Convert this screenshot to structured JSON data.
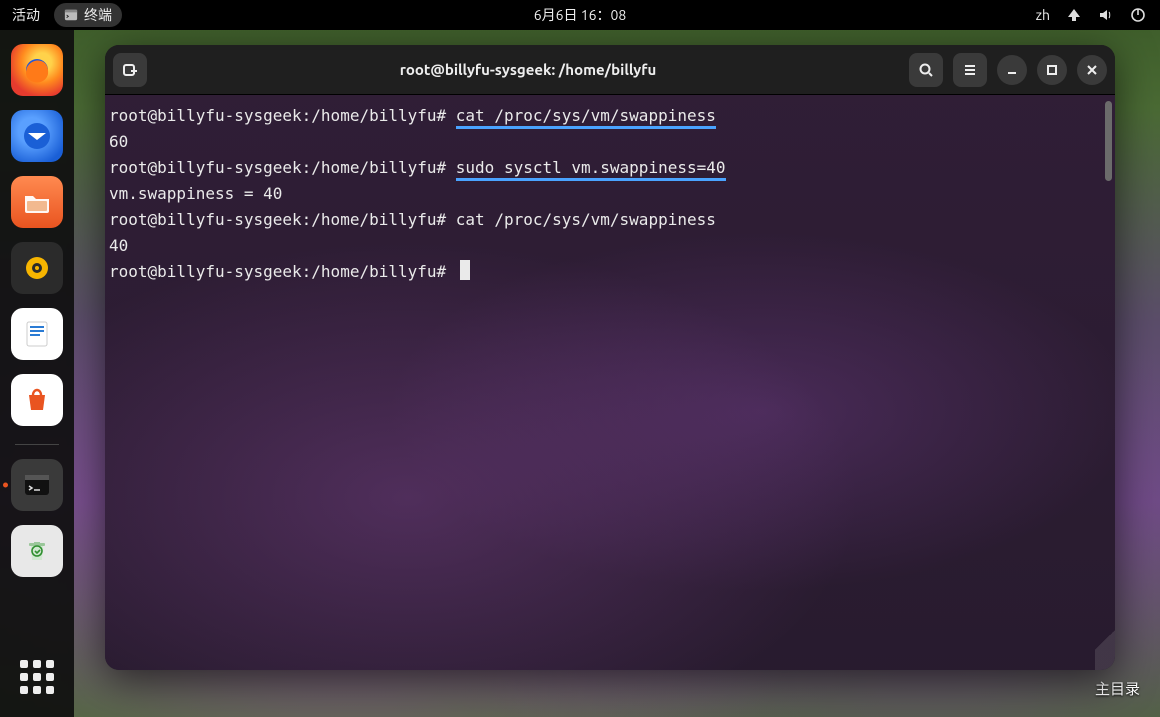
{
  "panel": {
    "activities": "活动",
    "app_menu": "终端",
    "clock": "6月6日 16：08",
    "ime": "zh"
  },
  "dock": {
    "items": [
      {
        "name": "firefox"
      },
      {
        "name": "thunderbird"
      },
      {
        "name": "files"
      },
      {
        "name": "rhythmbox"
      },
      {
        "name": "libreoffice-writer"
      },
      {
        "name": "ubuntu-software"
      },
      {
        "name": "terminal",
        "running": true
      },
      {
        "name": "trash"
      }
    ]
  },
  "desktop": {
    "home_label": "主目录"
  },
  "terminal": {
    "title": "root@billyfu-sysgeek: /home/billyfu",
    "prompt": "root@billyfu-sysgeek:/home/billyfu#",
    "lines": [
      {
        "prompt": true,
        "cmd": "cat /proc/sys/vm/swappiness",
        "hl": true
      },
      {
        "out": "60"
      },
      {
        "prompt": true,
        "cmd": "sudo sysctl vm.swappiness=40",
        "hl": true
      },
      {
        "out": "vm.swappiness = 40"
      },
      {
        "prompt": true,
        "cmd": "cat /proc/sys/vm/swappiness"
      },
      {
        "out": "40"
      },
      {
        "prompt": true,
        "cmd": "",
        "cursor": true
      }
    ]
  }
}
